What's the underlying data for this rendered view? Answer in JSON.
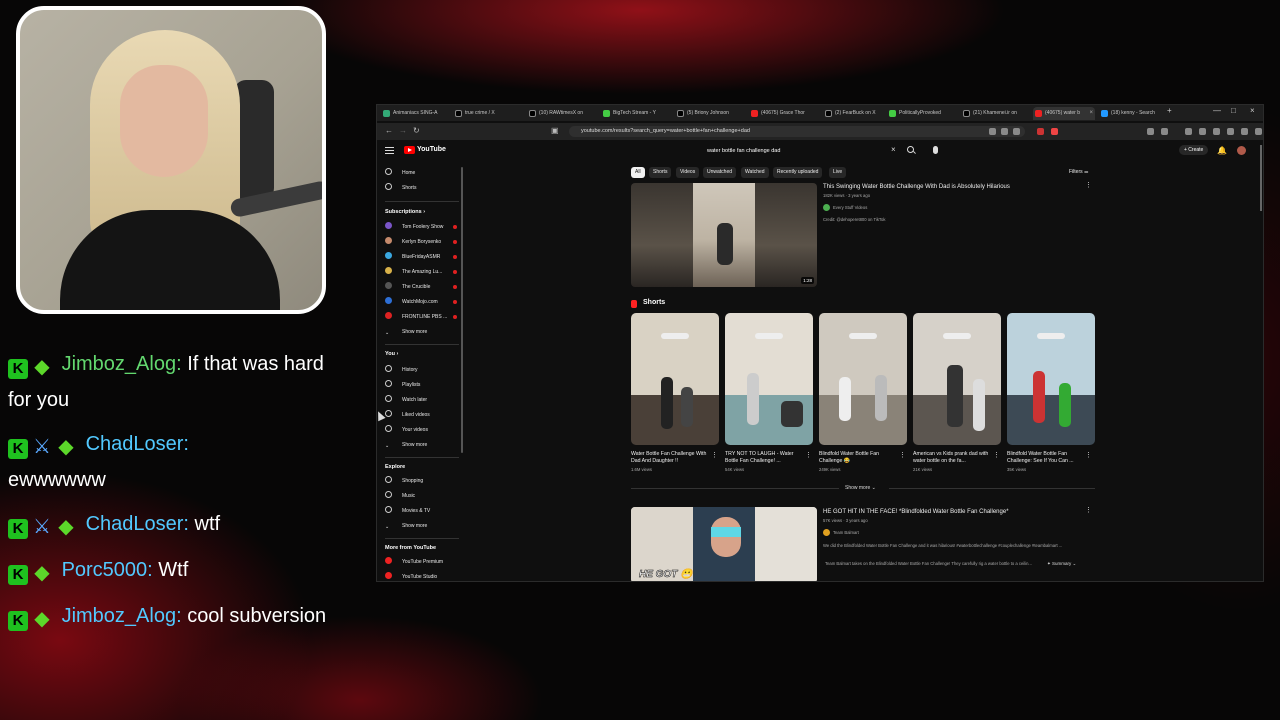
{
  "chat": [
    {
      "user": "Jimboz_Alog:",
      "text": "If that was hard for you",
      "badges": [
        "k-badge",
        "gem-badge"
      ]
    },
    {
      "user": "ChadLoser:",
      "text": "ewwwwww",
      "badges": [
        "k-badge",
        "sword-badge",
        "gem-badge"
      ]
    },
    {
      "user": "ChadLoser:",
      "text": "wtf",
      "badges": [
        "k-badge",
        "sword-badge",
        "gem-badge"
      ]
    },
    {
      "user": "Porc5000:",
      "text": "Wtf",
      "badges": [
        "k-badge",
        "gem-badge"
      ]
    },
    {
      "user": "Jimboz_Alog:",
      "text": "cool subversion",
      "badges": [
        "k-badge",
        "gem-badge"
      ]
    }
  ],
  "browser": {
    "tabs": [
      "Animaniacs SING-A",
      "true crime / X",
      "(10) RAWtimesX on",
      "BigTech Stream - Y",
      "(5) Briony Johnson",
      "(40675) Grace Thor",
      "(2) FearBuck on X",
      "PoliticallyProvoked",
      "(21) Khamenei.ir on",
      "(40675) water b",
      "(18) kenny - Search"
    ],
    "url": "youtube.com/results?search_query=water+bottle+fan+challenge+dad",
    "window_controls": [
      "—",
      "□",
      "×"
    ]
  },
  "youtube": {
    "logo_text": "YouTube",
    "search_value": "water bottle fan challenge dad",
    "create_label": "+ Create",
    "filters_label": "Filters",
    "chips": [
      "All",
      "Shorts",
      "Videos",
      "Unwatched",
      "Watched",
      "Recently uploaded",
      "Live"
    ],
    "sidebar": {
      "top": [
        "Home",
        "Shorts"
      ],
      "subscriptions_heading": "Subscriptions ›",
      "subscriptions": [
        "Tom Foolery Show",
        "Kerlyn Borysenko",
        "BlueFridayASMR",
        "The Amazing Lu...",
        "The Crucible",
        "WatchMojo.com",
        "FRONTLINE PBS ..."
      ],
      "sub_show_more": "Show more",
      "you_heading": "You ›",
      "you": [
        "History",
        "Playlists",
        "Watch later",
        "Liked videos",
        "Your videos"
      ],
      "you_show_more": "Show more",
      "explore_heading": "Explore",
      "explore": [
        "Shopping",
        "Music",
        "Movies & TV"
      ],
      "explore_show_more": "Show more",
      "more_heading": "More from YouTube",
      "more": [
        "YouTube Premium",
        "YouTube Studio"
      ]
    },
    "video1": {
      "title": "This Swinging Water Bottle Challenge With Dad is Absolutely Hilarious",
      "meta": "182K views · 3 years ago",
      "channel": "Every Stuff Videos",
      "credit": "Credit: @dehoperet800 on TikTok",
      "duration": "1:28"
    },
    "shorts_heading": "Shorts",
    "shorts": [
      {
        "title": "Water Bottle Fan Challenge With Dad And Daughter !!",
        "views": "1.6M views"
      },
      {
        "title": "TRY NOT TO LAUGH - Water Bottle Fan Challenge! ...",
        "views": "54K views"
      },
      {
        "title": "Blindfold Water Bottle Fan Challenge 😂",
        "views": "249K views"
      },
      {
        "title": "American vs Kids prank dad with water bottle on the fa...",
        "views": "21K views"
      },
      {
        "title": "Blindfold Water Bottle Fan Challenge: See If You Can ...",
        "views": "35K views"
      }
    ],
    "shorts_show_more": "Show more ⌄",
    "video2": {
      "title": "HE GOT HIT IN THE FACE! *Blindfolded Water Bottle Fan Challenge*",
      "meta": "57K views · 3 years ago",
      "channel": "Team Balmart",
      "desc": "We did the Blindfolded Water Bottle Fan Challenge and it was hilarious! #waterbottlechallenge #couplechallenge #teambalmart ...",
      "desc2": "Team Balmart takes on the Blindfolded Water Bottle Fan Challenge! They carefully rig a water bottle to a ceilin...",
      "summary": "✦ Summary ⌄",
      "thumb_caption": "HE GOT 😬"
    }
  }
}
